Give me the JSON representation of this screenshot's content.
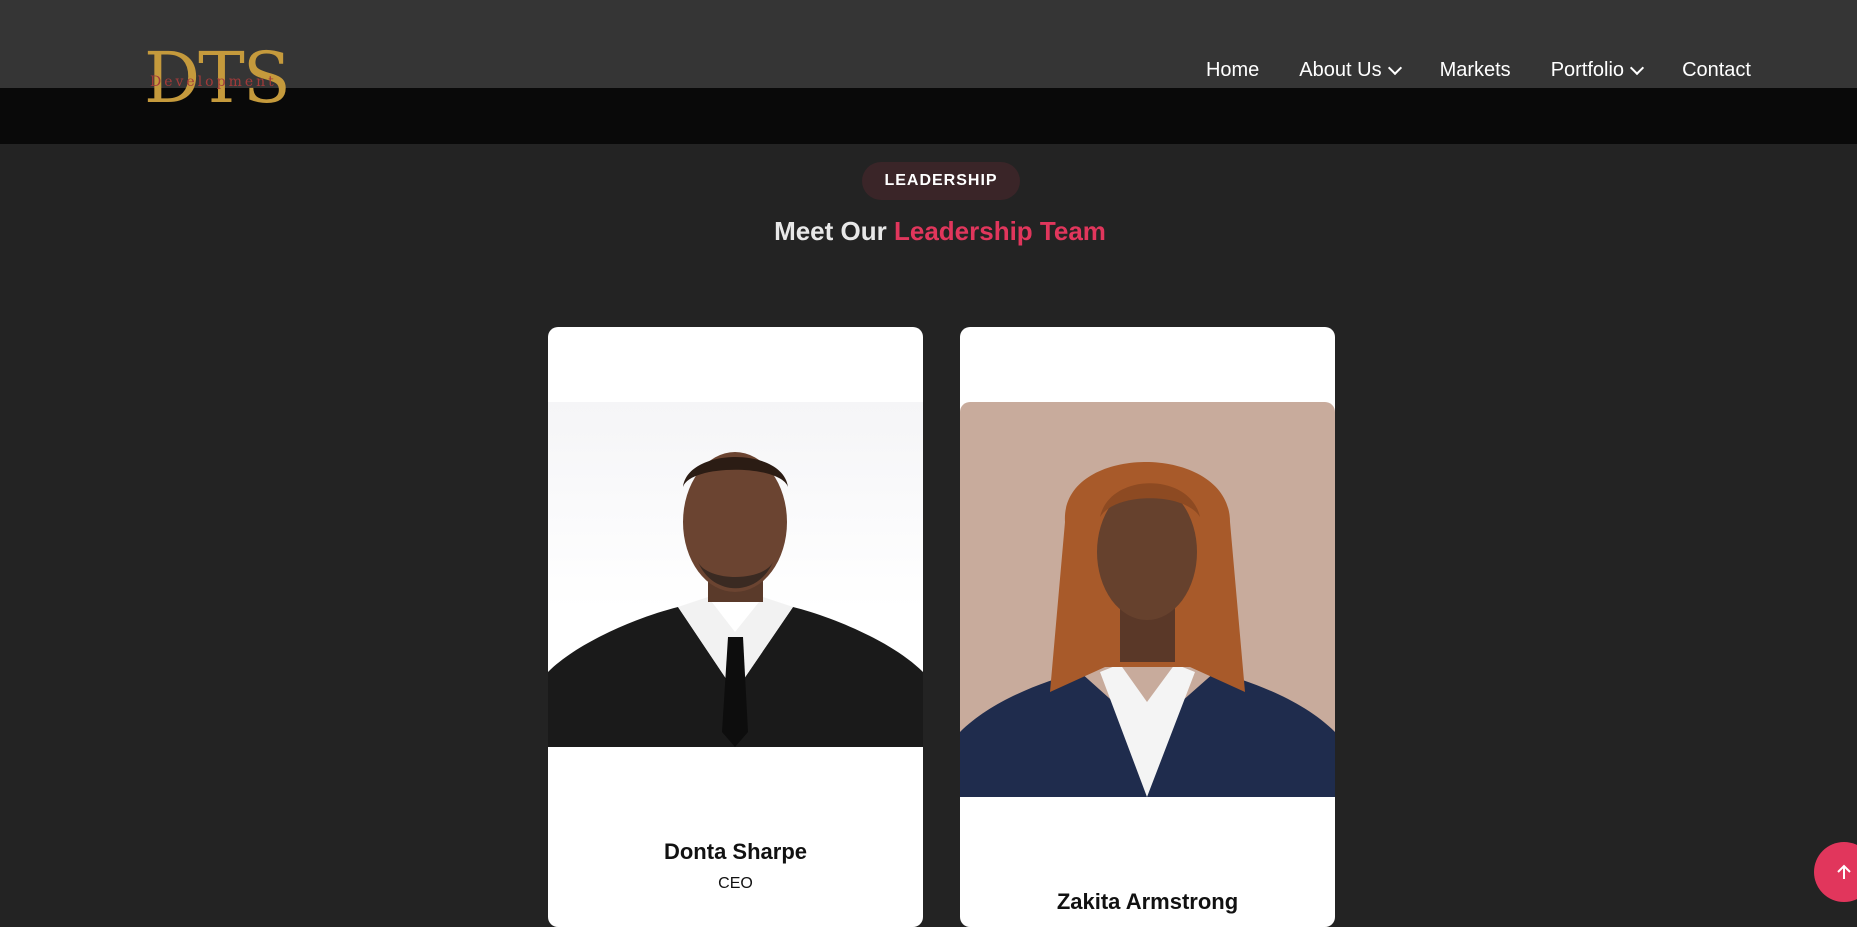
{
  "header": {
    "logo_text": "DTS",
    "logo_subtext": "Development",
    "nav": [
      {
        "label": "Home"
      },
      {
        "label": "About Us",
        "dropdown": true
      },
      {
        "label": "Markets"
      },
      {
        "label": "Portfolio",
        "dropdown": true
      },
      {
        "label": "Contact"
      }
    ]
  },
  "section": {
    "badge": "LEADERSHIP",
    "title_plain": "Meet Our ",
    "title_accent": "Leadership Team"
  },
  "team": [
    {
      "name": "Donta Sharpe",
      "role": "CEO"
    },
    {
      "name": "Zakita Armstrong",
      "role": ""
    }
  ],
  "colors": {
    "accent": "#e1365c",
    "logo_gold": "#c59a3c",
    "background": "#232323"
  },
  "icons": {
    "scroll_top": "arrow-up-icon"
  }
}
